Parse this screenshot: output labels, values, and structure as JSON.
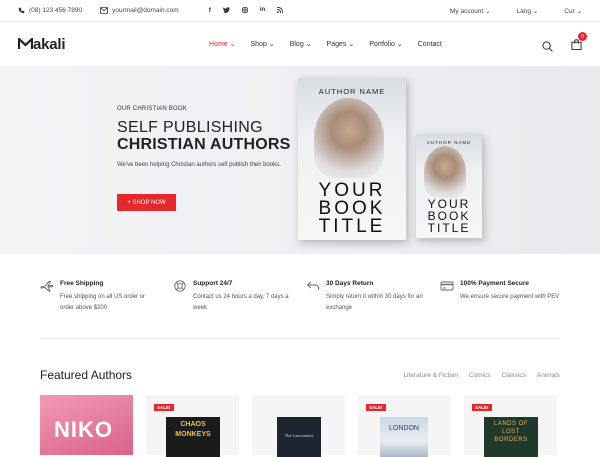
{
  "topbar": {
    "phone": "(08) 123 456 7890",
    "email": "yourmail@domain.com",
    "social": [
      "f",
      "t",
      "ig",
      "in",
      "rss"
    ],
    "account": "My account",
    "lang": "Lang",
    "cur": "Cur"
  },
  "header": {
    "logo_rest": "akali",
    "nav": [
      "Home",
      "Shop",
      "Blog",
      "Pages",
      "Portfolio",
      "Contact"
    ],
    "cart_count": "0"
  },
  "hero": {
    "subtitle": "OUR CHRISTIAN BOOK",
    "title1": "SELF PUBLISHING",
    "title2": "CHRISTIAN AUTHORS",
    "desc": "We've been helping Christian authors self publish their books.",
    "button": "+ SHOP NOW",
    "book_author": "AUTHOR NAME",
    "book_title": [
      "YOUR",
      "BOOK",
      "TITLE"
    ]
  },
  "features": [
    {
      "title": "Free Shipping",
      "desc": "Free shipping on all US order or order above $200",
      "icon": "plane-icon"
    },
    {
      "title": "Support 24/7",
      "desc": "Contact us 24 hours a day, 7 days a week",
      "icon": "lifebuoy-icon"
    },
    {
      "title": "30 Days Return",
      "desc": "Simply return it within 30 days for an exchange",
      "icon": "return-icon"
    },
    {
      "title": "100% Payment Secure",
      "desc": "We ensure secure payment with PEV",
      "icon": "card-icon"
    }
  ],
  "featured": {
    "title": "Featured Authors",
    "tabs": [
      "Literature & Fiction",
      "Comics",
      "Classics",
      "Animals"
    ],
    "sale_label": "SALE!",
    "books": [
      "NIKO",
      "CHAOS MONKEYS",
      "The Laocoonets",
      "LONDON",
      "LANDS OF LOST BORDERS"
    ]
  }
}
